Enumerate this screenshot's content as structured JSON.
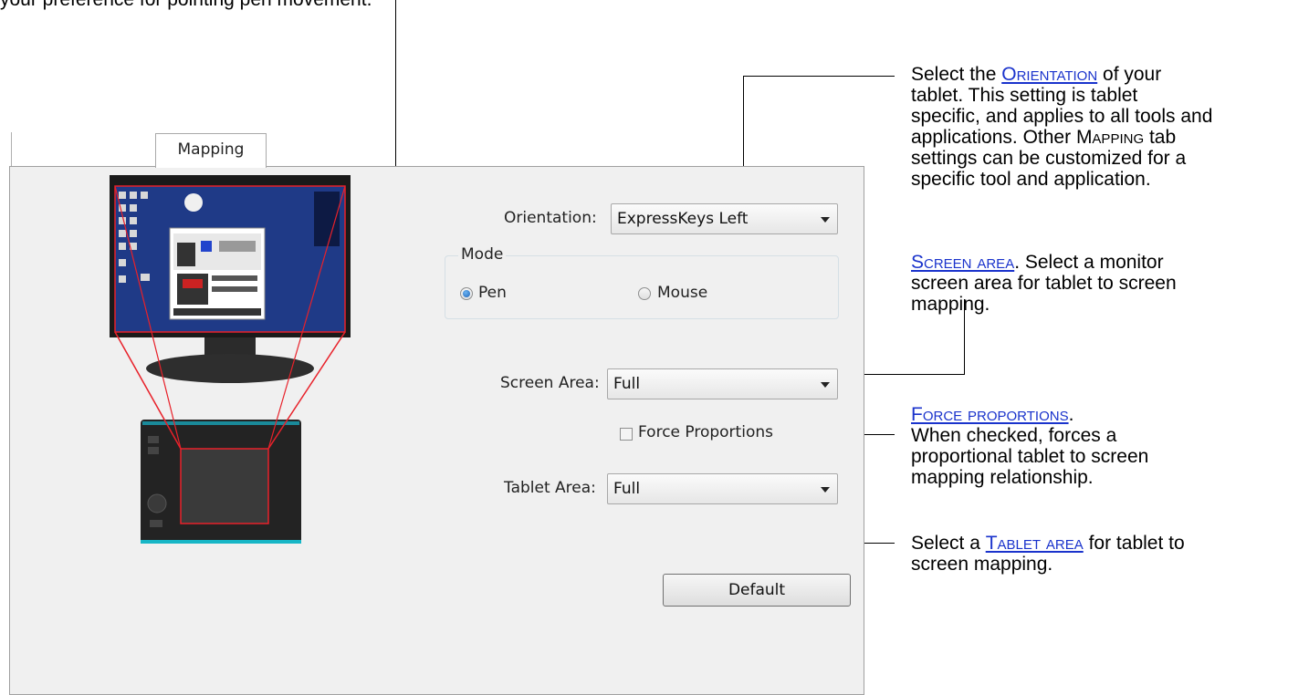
{
  "callouts": {
    "top_partial": "your preference for pointing pen movement.",
    "orientation": {
      "pre": "Select the ",
      "link": "Orientation",
      "post": " of your",
      "line2": "tablet.  This setting is tablet",
      "line3": "specific, and applies to all tools and",
      "line4_pre": "applications.  Other ",
      "line4_sc": "Mapping",
      "line4_post": " tab",
      "line5": "settings can be customized for a",
      "line6": "specific tool and application."
    },
    "screen_area": {
      "link": "Screen area",
      "post": ".  Select a monitor",
      "line2": "screen area for tablet to screen",
      "line3": "mapping."
    },
    "force_proportions": {
      "link": "Force proportions",
      "post": ".",
      "line2": "When checked, forces a",
      "line3": "proportional tablet to screen",
      "line4": "mapping relationship."
    },
    "tablet_area": {
      "pre": "Select a ",
      "link": "Tablet area",
      "post": " for tablet to",
      "line2": "screen mapping."
    }
  },
  "dialog": {
    "tab_label": "Mapping",
    "orientation_label": "Orientation:",
    "orientation_value": "ExpressKeys Left",
    "mode_label": "Mode",
    "mode_pen": "Pen",
    "mode_mouse": "Mouse",
    "screen_area_label": "Screen Area:",
    "screen_area_value": "Full",
    "force_proportions_label": "Force Proportions",
    "tablet_area_label": "Tablet Area:",
    "tablet_area_value": "Full",
    "default_button": "Default"
  },
  "colors": {
    "link": "#1a33cc",
    "mapping_lines": "#e8212a",
    "desktop": "#1f3a87"
  }
}
